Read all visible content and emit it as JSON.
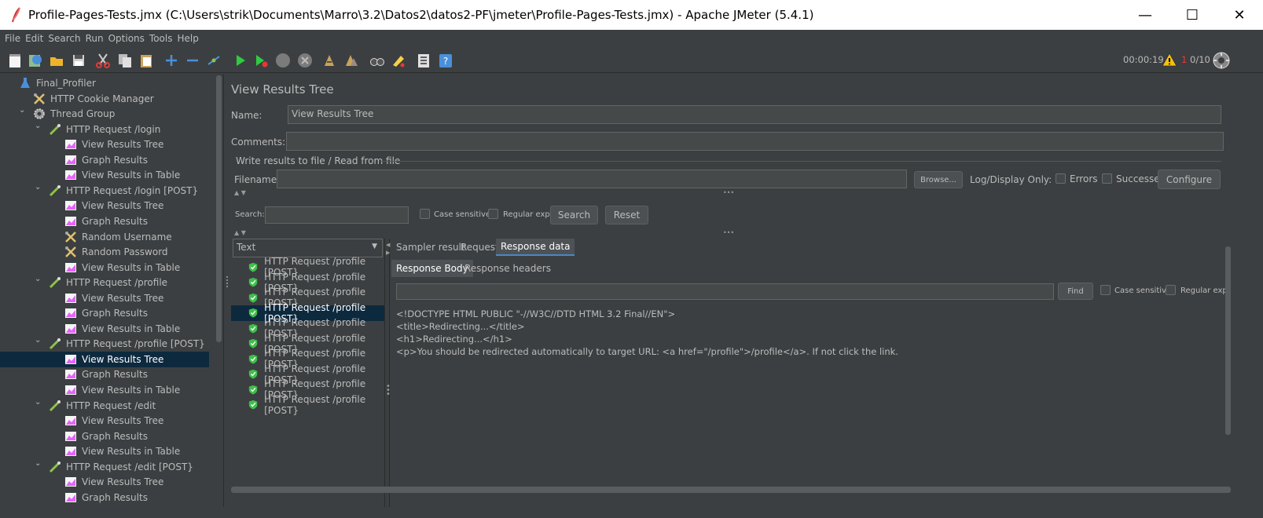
{
  "window": {
    "title": "Profile-Pages-Tests.jmx (C:\\Users\\strik\\Documents\\Marro\\3.2\\Datos2\\datos2-PF\\jmeter\\Profile-Pages-Tests.jmx) - Apache JMeter (5.4.1)",
    "minimize": "—",
    "maximize": "☐",
    "close": "✕"
  },
  "menu": [
    "File",
    "Edit",
    "Search",
    "Run",
    "Options",
    "Tools",
    "Help"
  ],
  "toolbar": {
    "elapsed": "00:00:19",
    "warn_count": "1",
    "threads": "0/10"
  },
  "tree": [
    {
      "label": "Final_Profiler",
      "level": 0,
      "icon": "test-plan-icon",
      "toggle": ""
    },
    {
      "label": "HTTP Cookie Manager",
      "level": 1,
      "icon": "config-tools-icon",
      "toggle": ""
    },
    {
      "label": "Thread Group",
      "level": 1,
      "icon": "gear-icon",
      "toggle": "v"
    },
    {
      "label": "HTTP Request /login",
      "level": 2,
      "icon": "pipette-icon",
      "toggle": "v"
    },
    {
      "label": "View Results Tree",
      "level": 3,
      "icon": "graph-icon",
      "toggle": ""
    },
    {
      "label": "Graph Results",
      "level": 3,
      "icon": "graph-icon",
      "toggle": ""
    },
    {
      "label": "View Results in Table",
      "level": 3,
      "icon": "graph-icon",
      "toggle": ""
    },
    {
      "label": "HTTP Request /login [POST}",
      "level": 2,
      "icon": "pipette-icon",
      "toggle": "v"
    },
    {
      "label": "View Results Tree",
      "level": 3,
      "icon": "graph-icon",
      "toggle": ""
    },
    {
      "label": "Graph Results",
      "level": 3,
      "icon": "graph-icon",
      "toggle": ""
    },
    {
      "label": "Random Username",
      "level": 3,
      "icon": "config-tools-icon",
      "toggle": ""
    },
    {
      "label": "Random Password",
      "level": 3,
      "icon": "config-tools-icon",
      "toggle": ""
    },
    {
      "label": "View Results in Table",
      "level": 3,
      "icon": "graph-icon",
      "toggle": ""
    },
    {
      "label": "HTTP Request /profile",
      "level": 2,
      "icon": "pipette-icon",
      "toggle": "v"
    },
    {
      "label": "View Results Tree",
      "level": 3,
      "icon": "graph-icon",
      "toggle": ""
    },
    {
      "label": "Graph Results",
      "level": 3,
      "icon": "graph-icon",
      "toggle": ""
    },
    {
      "label": "View Results in Table",
      "level": 3,
      "icon": "graph-icon",
      "toggle": ""
    },
    {
      "label": "HTTP Request /profile [POST}",
      "level": 2,
      "icon": "pipette-icon",
      "toggle": "v"
    },
    {
      "label": "View Results Tree",
      "level": 3,
      "icon": "graph-icon",
      "toggle": "",
      "selected": true
    },
    {
      "label": "Graph Results",
      "level": 3,
      "icon": "graph-icon",
      "toggle": ""
    },
    {
      "label": "View Results in Table",
      "level": 3,
      "icon": "graph-icon",
      "toggle": ""
    },
    {
      "label": "HTTP Request /edit",
      "level": 2,
      "icon": "pipette-icon",
      "toggle": "v"
    },
    {
      "label": "View Results Tree",
      "level": 3,
      "icon": "graph-icon",
      "toggle": ""
    },
    {
      "label": "Graph Results",
      "level": 3,
      "icon": "graph-icon",
      "toggle": ""
    },
    {
      "label": "View Results in Table",
      "level": 3,
      "icon": "graph-icon",
      "toggle": ""
    },
    {
      "label": "HTTP Request /edit [POST}",
      "level": 2,
      "icon": "pipette-icon",
      "toggle": "v"
    },
    {
      "label": "View Results Tree",
      "level": 3,
      "icon": "graph-icon",
      "toggle": ""
    },
    {
      "label": "Graph Results",
      "level": 3,
      "icon": "graph-icon",
      "toggle": ""
    }
  ],
  "panel": {
    "heading": "View Results Tree",
    "name_label": "Name:",
    "name_value": "View Results Tree",
    "comments_label": "Comments:",
    "comments_value": "",
    "file_section": "Write results to file / Read from file",
    "filename_label": "Filename",
    "filename_value": "",
    "browse": "Browse...",
    "log_display": "Log/Display Only:",
    "errors": "Errors",
    "successes": "Successes",
    "configure": "Configure",
    "search_label": "Search:",
    "search_value": "",
    "case_sensitive": "Case sensitive",
    "regular_exp": "Regular exp.",
    "search_btn": "Search",
    "reset_btn": "Reset",
    "renderer": "Text",
    "tabs": [
      "Sampler result",
      "Request",
      "Response data"
    ],
    "subtabs": [
      "Response Body",
      "Response headers"
    ],
    "find_btn": "Find",
    "find_case": "Case sensitive",
    "find_regex": "Regular exp."
  },
  "results": [
    {
      "label": "HTTP Request /profile [POST}"
    },
    {
      "label": "HTTP Request /profile [POST}"
    },
    {
      "label": "HTTP Request /profile [POST}"
    },
    {
      "label": "HTTP Request /profile [POST}",
      "selected": true
    },
    {
      "label": "HTTP Request /profile [POST}"
    },
    {
      "label": "HTTP Request /profile [POST}"
    },
    {
      "label": "HTTP Request /profile [POST}"
    },
    {
      "label": "HTTP Request /profile [POST}"
    },
    {
      "label": "HTTP Request /profile [POST}"
    },
    {
      "label": "HTTP Request /profile [POST}"
    }
  ],
  "response_body": [
    "<!DOCTYPE HTML PUBLIC \"-//W3C//DTD HTML 3.2 Final//EN\">",
    "<title>Redirecting...</title>",
    "<h1>Redirecting...</h1>",
    "<p>You should be redirected automatically to target URL: <a href=\"/profile\">/profile</a>. If not click the link."
  ],
  "colors": {
    "bg": "#3c3f41",
    "selection": "#0d293e",
    "success": "#3fbf4a"
  }
}
